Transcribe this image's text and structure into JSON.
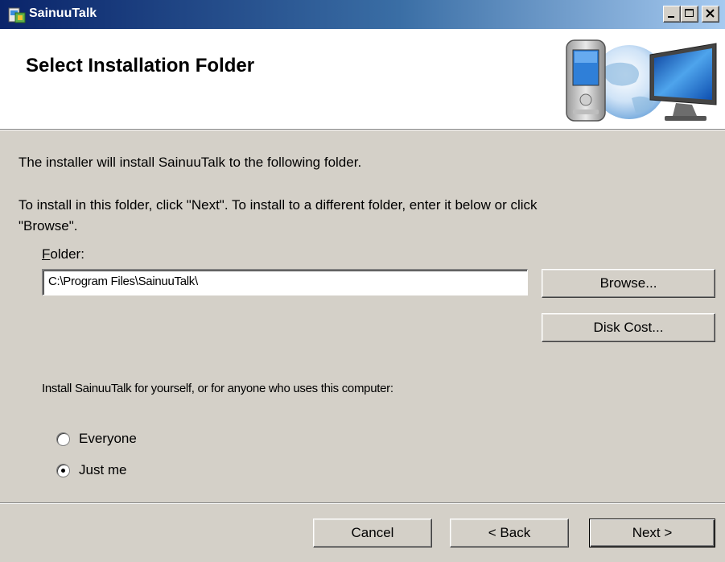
{
  "window": {
    "title": "SainuuTalk",
    "colors": {
      "titlebar_start": "#0a246a",
      "titlebar_end": "#a6caf0",
      "face": "#d4d0c8"
    },
    "controls": {
      "minimize_icon": "minimize-icon",
      "maximize_icon": "maximize-icon",
      "close_icon": "close-icon"
    }
  },
  "header": {
    "title": "Select Installation Folder",
    "art_icon": "device-globe-monitor-icon"
  },
  "body": {
    "intro_line1": "The installer will install SainuuTalk to the following folder.",
    "intro_line2": "To install in this folder, click \"Next\". To install to a different folder, enter it below or click",
    "intro_line3": "\"Browse\".",
    "folder_label_accel": "F",
    "folder_label_rest": "older:",
    "folder_value": "C:\\Program Files\\SainuuTalk\\",
    "browse_label": "Browse...",
    "disk_cost_label": "Disk Cost...",
    "install_for_text": "Install SainuuTalk for yourself, or for anyone who uses this computer:",
    "radio_options": [
      {
        "label": "Everyone",
        "selected": false
      },
      {
        "label": "Just me",
        "selected": true
      }
    ]
  },
  "footer": {
    "cancel_label": "Cancel",
    "back_label": "< Back",
    "next_label": "Next >"
  }
}
